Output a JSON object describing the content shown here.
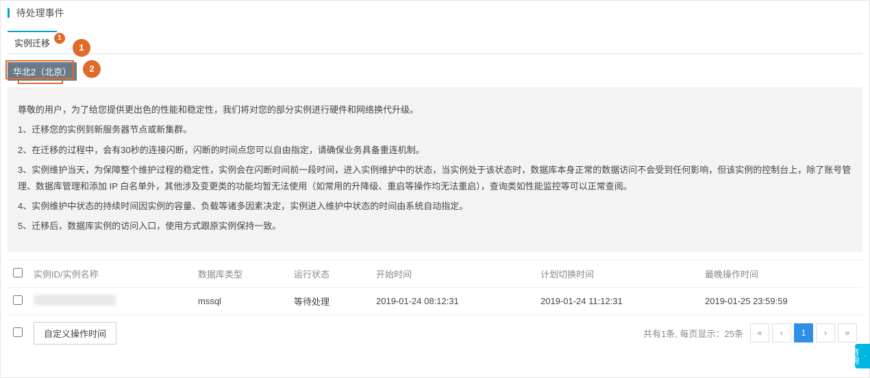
{
  "title": "待处理事件",
  "tabs": [
    {
      "label": "实例迁移",
      "active": true
    }
  ],
  "callouts": {
    "c1": "1",
    "c2": "2",
    "badge": "1"
  },
  "region": {
    "label": "华北2（北京）"
  },
  "notice": {
    "intro": "尊敬的用户，为了给您提供更出色的性能和稳定性，我们将对您的部分实例进行硬件和网络换代升级。",
    "items": [
      "1、迁移您的实例到新服务器节点或新集群。",
      "2、在迁移的过程中，会有30秒的连接闪断，闪断的时间点您可以自由指定，请确保业务具备重连机制。",
      "3、实例维护当天，为保障整个维护过程的稳定性，实例会在闪断时间前一段时间，进入实例维护中的状态，当实例处于该状态时，数据库本身正常的数据访问不会受到任何影响，但该实例的控制台上，除了账号管理、数据库管理和添加 IP 白名单外，其他涉及变更类的功能均暂无法使用（如常用的升降级、重启等操作均无法重启），查询类如性能监控等可以正常查阅。",
      "4、实例维护中状态的持续时间因实例的容量、负载等诸多因素决定，实例进入维护中状态的时间由系统自动指定。",
      "5、迁移后，数据库实例的访问入口，使用方式跟原实例保持一致。"
    ]
  },
  "table": {
    "headers": {
      "id": "实例ID/实例名称",
      "db": "数据库类型",
      "status": "运行状态",
      "start": "开始时间",
      "plan": "计划切换时间",
      "latest": "最晚操作时间"
    },
    "rows": [
      {
        "id": "",
        "db": "mssql",
        "status": "等待处理",
        "start": "2019-01-24 08:12:31",
        "plan": "2019-01-24 11:12:31",
        "latest": "2019-01-25 23:59:59"
      }
    ]
  },
  "footer": {
    "custom_button": "自定义操作时间",
    "page_info": "共有1条, 每页显示：25条",
    "pager": {
      "prev2": "«",
      "prev": "‹",
      "current": "1",
      "next": "›",
      "next2": "»"
    }
  },
  "help": {
    "label": "咨询",
    "dot": "·"
  }
}
